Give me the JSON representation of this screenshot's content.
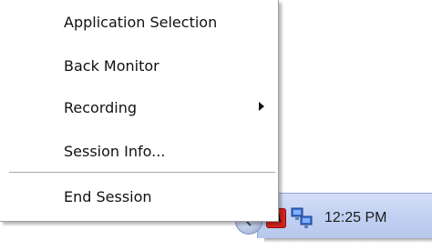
{
  "context_menu": {
    "items": [
      {
        "label": "Application Selection",
        "has_submenu": false
      },
      {
        "label": "Back Monitor",
        "has_submenu": false
      },
      {
        "label": "Recording",
        "has_submenu": true
      },
      {
        "label": "Session Info...",
        "has_submenu": false
      },
      {
        "label": "End Session",
        "has_submenu": false
      }
    ]
  },
  "taskbar": {
    "tray_icons": [
      "show-hidden-icons-chevron-icon",
      "application-a-icon",
      "network-connection-icon"
    ],
    "clock": "12:25 PM"
  },
  "colors": {
    "menu_background": "#ffffff",
    "menu_text": "#111111",
    "tray_background": "#c3d2f2",
    "icon_a_red": "#d6241e"
  }
}
